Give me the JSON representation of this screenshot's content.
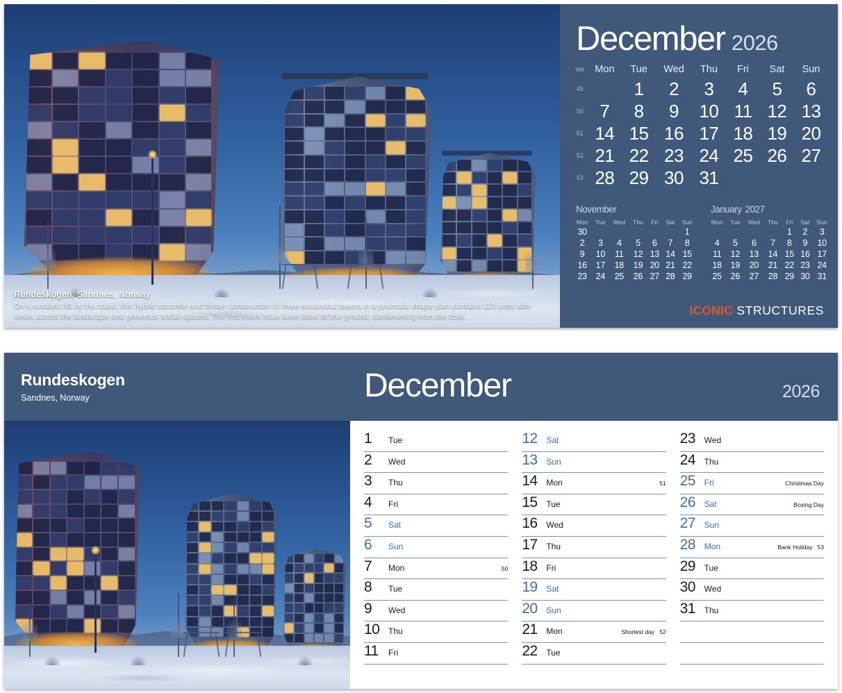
{
  "top": {
    "photo_caption": {
      "title": "Rundeskogen, Sandnes, Norway",
      "body": "On a wooded hill by the coast, this hybrid concrete and timber construction of three residential towers in a prismatic shape plan contains 113 units with views across the landscape and generous social spaces. The first floors have been lifted off the ground, cantilevering from the core."
    },
    "month": "December",
    "year": "2026",
    "week_header": "Wk",
    "weekdays": [
      "Mon",
      "Tue",
      "Wed",
      "Thu",
      "Fri",
      "Sat",
      "Sun"
    ],
    "weeks": [
      {
        "wk": "49",
        "days": [
          "",
          "1",
          "2",
          "3",
          "4",
          "5",
          "6"
        ]
      },
      {
        "wk": "50",
        "days": [
          "7",
          "8",
          "9",
          "10",
          "11",
          "12",
          "13"
        ]
      },
      {
        "wk": "51",
        "days": [
          "14",
          "15",
          "16",
          "17",
          "18",
          "19",
          "20"
        ]
      },
      {
        "wk": "52",
        "days": [
          "21",
          "22",
          "23",
          "24",
          "25",
          "26",
          "27"
        ]
      },
      {
        "wk": "53",
        "days": [
          "28",
          "29",
          "30",
          "31",
          "",
          "",
          ""
        ]
      }
    ],
    "mini_prev": {
      "month": "November",
      "year": "",
      "weekdays": [
        "Mon",
        "Tue",
        "Wed",
        "Thu",
        "Fri",
        "Sat",
        "Sun"
      ],
      "weeks": [
        [
          "30",
          "",
          "",
          "",
          "",
          "",
          "1"
        ],
        [
          "2",
          "3",
          "4",
          "5",
          "6",
          "7",
          "8"
        ],
        [
          "9",
          "10",
          "11",
          "12",
          "13",
          "14",
          "15"
        ],
        [
          "16",
          "17",
          "18",
          "19",
          "20",
          "21",
          "22"
        ],
        [
          "23",
          "24",
          "25",
          "26",
          "27",
          "28",
          "29"
        ]
      ]
    },
    "mini_next": {
      "month": "January",
      "year": "2027",
      "weekdays": [
        "Mon",
        "Tue",
        "Wed",
        "Thu",
        "Fri",
        "Sat",
        "Sun"
      ],
      "weeks": [
        [
          "",
          "",
          "",
          "",
          "1",
          "2",
          "3"
        ],
        [
          "4",
          "5",
          "6",
          "7",
          "8",
          "9",
          "10"
        ],
        [
          "11",
          "12",
          "13",
          "14",
          "15",
          "16",
          "17"
        ],
        [
          "18",
          "19",
          "20",
          "21",
          "22",
          "23",
          "24"
        ],
        [
          "25",
          "26",
          "27",
          "28",
          "29",
          "30",
          "31"
        ]
      ]
    },
    "brand": {
      "part1": "ICONIC",
      "part2": "STRUCTURES",
      "accent": "#e8551d"
    }
  },
  "bottom": {
    "location_name": "Rundeskogen",
    "location_sub": "Sandnes, Norway",
    "month": "December",
    "year": "2026",
    "columns": [
      [
        {
          "num": "1",
          "dow": "Tue",
          "note": "",
          "wk": "",
          "weekend": false,
          "holiday": false
        },
        {
          "num": "2",
          "dow": "Wed",
          "note": "",
          "wk": "",
          "weekend": false,
          "holiday": false
        },
        {
          "num": "3",
          "dow": "Thu",
          "note": "",
          "wk": "",
          "weekend": false,
          "holiday": false
        },
        {
          "num": "4",
          "dow": "Fri",
          "note": "",
          "wk": "",
          "weekend": false,
          "holiday": false
        },
        {
          "num": "5",
          "dow": "Sat",
          "note": "",
          "wk": "",
          "weekend": true,
          "holiday": false
        },
        {
          "num": "6",
          "dow": "Sun",
          "note": "",
          "wk": "",
          "weekend": true,
          "holiday": false
        },
        {
          "num": "7",
          "dow": "Mon",
          "note": "",
          "wk": "50",
          "weekend": false,
          "holiday": false
        },
        {
          "num": "8",
          "dow": "Tue",
          "note": "",
          "wk": "",
          "weekend": false,
          "holiday": false
        },
        {
          "num": "9",
          "dow": "Wed",
          "note": "",
          "wk": "",
          "weekend": false,
          "holiday": false
        },
        {
          "num": "10",
          "dow": "Thu",
          "note": "",
          "wk": "",
          "weekend": false,
          "holiday": false
        },
        {
          "num": "11",
          "dow": "Fri",
          "note": "",
          "wk": "",
          "weekend": false,
          "holiday": false
        }
      ],
      [
        {
          "num": "12",
          "dow": "Sat",
          "note": "",
          "wk": "",
          "weekend": true,
          "holiday": false
        },
        {
          "num": "13",
          "dow": "Sun",
          "note": "",
          "wk": "",
          "weekend": true,
          "holiday": false
        },
        {
          "num": "14",
          "dow": "Mon",
          "note": "",
          "wk": "51",
          "weekend": false,
          "holiday": false
        },
        {
          "num": "15",
          "dow": "Tue",
          "note": "",
          "wk": "",
          "weekend": false,
          "holiday": false
        },
        {
          "num": "16",
          "dow": "Wed",
          "note": "",
          "wk": "",
          "weekend": false,
          "holiday": false
        },
        {
          "num": "17",
          "dow": "Thu",
          "note": "",
          "wk": "",
          "weekend": false,
          "holiday": false
        },
        {
          "num": "18",
          "dow": "Fri",
          "note": "",
          "wk": "",
          "weekend": false,
          "holiday": false
        },
        {
          "num": "19",
          "dow": "Sat",
          "note": "",
          "wk": "",
          "weekend": true,
          "holiday": false
        },
        {
          "num": "20",
          "dow": "Sun",
          "note": "",
          "wk": "",
          "weekend": true,
          "holiday": false
        },
        {
          "num": "21",
          "dow": "Mon",
          "note": "Shortest day",
          "wk": "52",
          "weekend": false,
          "holiday": false
        },
        {
          "num": "22",
          "dow": "Tue",
          "note": "",
          "wk": "",
          "weekend": false,
          "holiday": false
        }
      ],
      [
        {
          "num": "23",
          "dow": "Wed",
          "note": "",
          "wk": "",
          "weekend": false,
          "holiday": false
        },
        {
          "num": "24",
          "dow": "Thu",
          "note": "",
          "wk": "",
          "weekend": false,
          "holiday": false
        },
        {
          "num": "25",
          "dow": "Fri",
          "note": "Christmas Day",
          "wk": "",
          "weekend": false,
          "holiday": true
        },
        {
          "num": "26",
          "dow": "Sat",
          "note": "Boxing Day",
          "wk": "",
          "weekend": true,
          "holiday": true
        },
        {
          "num": "27",
          "dow": "Sun",
          "note": "",
          "wk": "",
          "weekend": true,
          "holiday": false
        },
        {
          "num": "28",
          "dow": "Mon",
          "note": "Bank Holiday",
          "wk": "53",
          "weekend": false,
          "holiday": true
        },
        {
          "num": "29",
          "dow": "Tue",
          "note": "",
          "wk": "",
          "weekend": false,
          "holiday": false
        },
        {
          "num": "30",
          "dow": "Wed",
          "note": "",
          "wk": "",
          "weekend": false,
          "holiday": false
        },
        {
          "num": "31",
          "dow": "Thu",
          "note": "",
          "wk": "",
          "weekend": false,
          "holiday": false
        },
        {
          "num": "",
          "dow": "",
          "note": "",
          "wk": "",
          "weekend": false,
          "holiday": false
        },
        {
          "num": "",
          "dow": "",
          "note": "",
          "wk": "",
          "weekend": false,
          "holiday": false
        }
      ]
    ]
  },
  "theme": {
    "panel_blue": "#40587a",
    "weekend_blue": "#3f6ea6",
    "rule_grey": "#8b8f96"
  }
}
